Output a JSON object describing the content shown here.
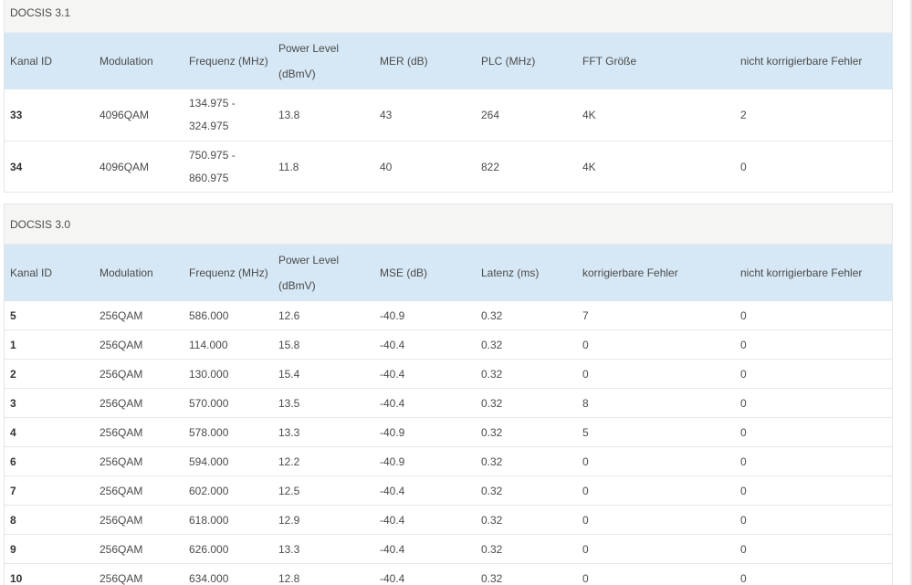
{
  "docsis31": {
    "title": "DOCSIS 3.1",
    "headers": [
      "Kanal ID",
      "Modulation",
      "Frequenz (MHz)",
      "Power Level (dBmV)",
      "MER (dB)",
      "PLC (MHz)",
      "FFT Größe",
      "nicht korrigierbare Fehler"
    ],
    "rows": [
      [
        "33",
        "4096QAM",
        "134.975 - 324.975",
        "13.8",
        "43",
        "264",
        "4K",
        "2"
      ],
      [
        "34",
        "4096QAM",
        "750.975 - 860.975",
        "11.8",
        "40",
        "822",
        "4K",
        "0"
      ]
    ]
  },
  "docsis30": {
    "title": "DOCSIS 3.0",
    "headers": [
      "Kanal ID",
      "Modulation",
      "Frequenz (MHz)",
      "Power Level (dBmV)",
      "MSE (dB)",
      "Latenz (ms)",
      "korrigierbare Fehler",
      "nicht korrigierbare Fehler"
    ],
    "rows": [
      [
        "5",
        "256QAM",
        "586.000",
        "12.6",
        "-40.9",
        "0.32",
        "7",
        "0"
      ],
      [
        "1",
        "256QAM",
        "114.000",
        "15.8",
        "-40.4",
        "0.32",
        "0",
        "0"
      ],
      [
        "2",
        "256QAM",
        "130.000",
        "15.4",
        "-40.4",
        "0.32",
        "0",
        "0"
      ],
      [
        "3",
        "256QAM",
        "570.000",
        "13.5",
        "-40.4",
        "0.32",
        "8",
        "0"
      ],
      [
        "4",
        "256QAM",
        "578.000",
        "13.3",
        "-40.9",
        "0.32",
        "5",
        "0"
      ],
      [
        "6",
        "256QAM",
        "594.000",
        "12.2",
        "-40.9",
        "0.32",
        "0",
        "0"
      ],
      [
        "7",
        "256QAM",
        "602.000",
        "12.5",
        "-40.4",
        "0.32",
        "0",
        "0"
      ],
      [
        "8",
        "256QAM",
        "618.000",
        "12.9",
        "-40.4",
        "0.32",
        "0",
        "0"
      ],
      [
        "9",
        "256QAM",
        "626.000",
        "13.3",
        "-40.4",
        "0.32",
        "0",
        "0"
      ],
      [
        "10",
        "256QAM",
        "634.000",
        "12.8",
        "-40.4",
        "0.32",
        "0",
        "0"
      ]
    ]
  }
}
